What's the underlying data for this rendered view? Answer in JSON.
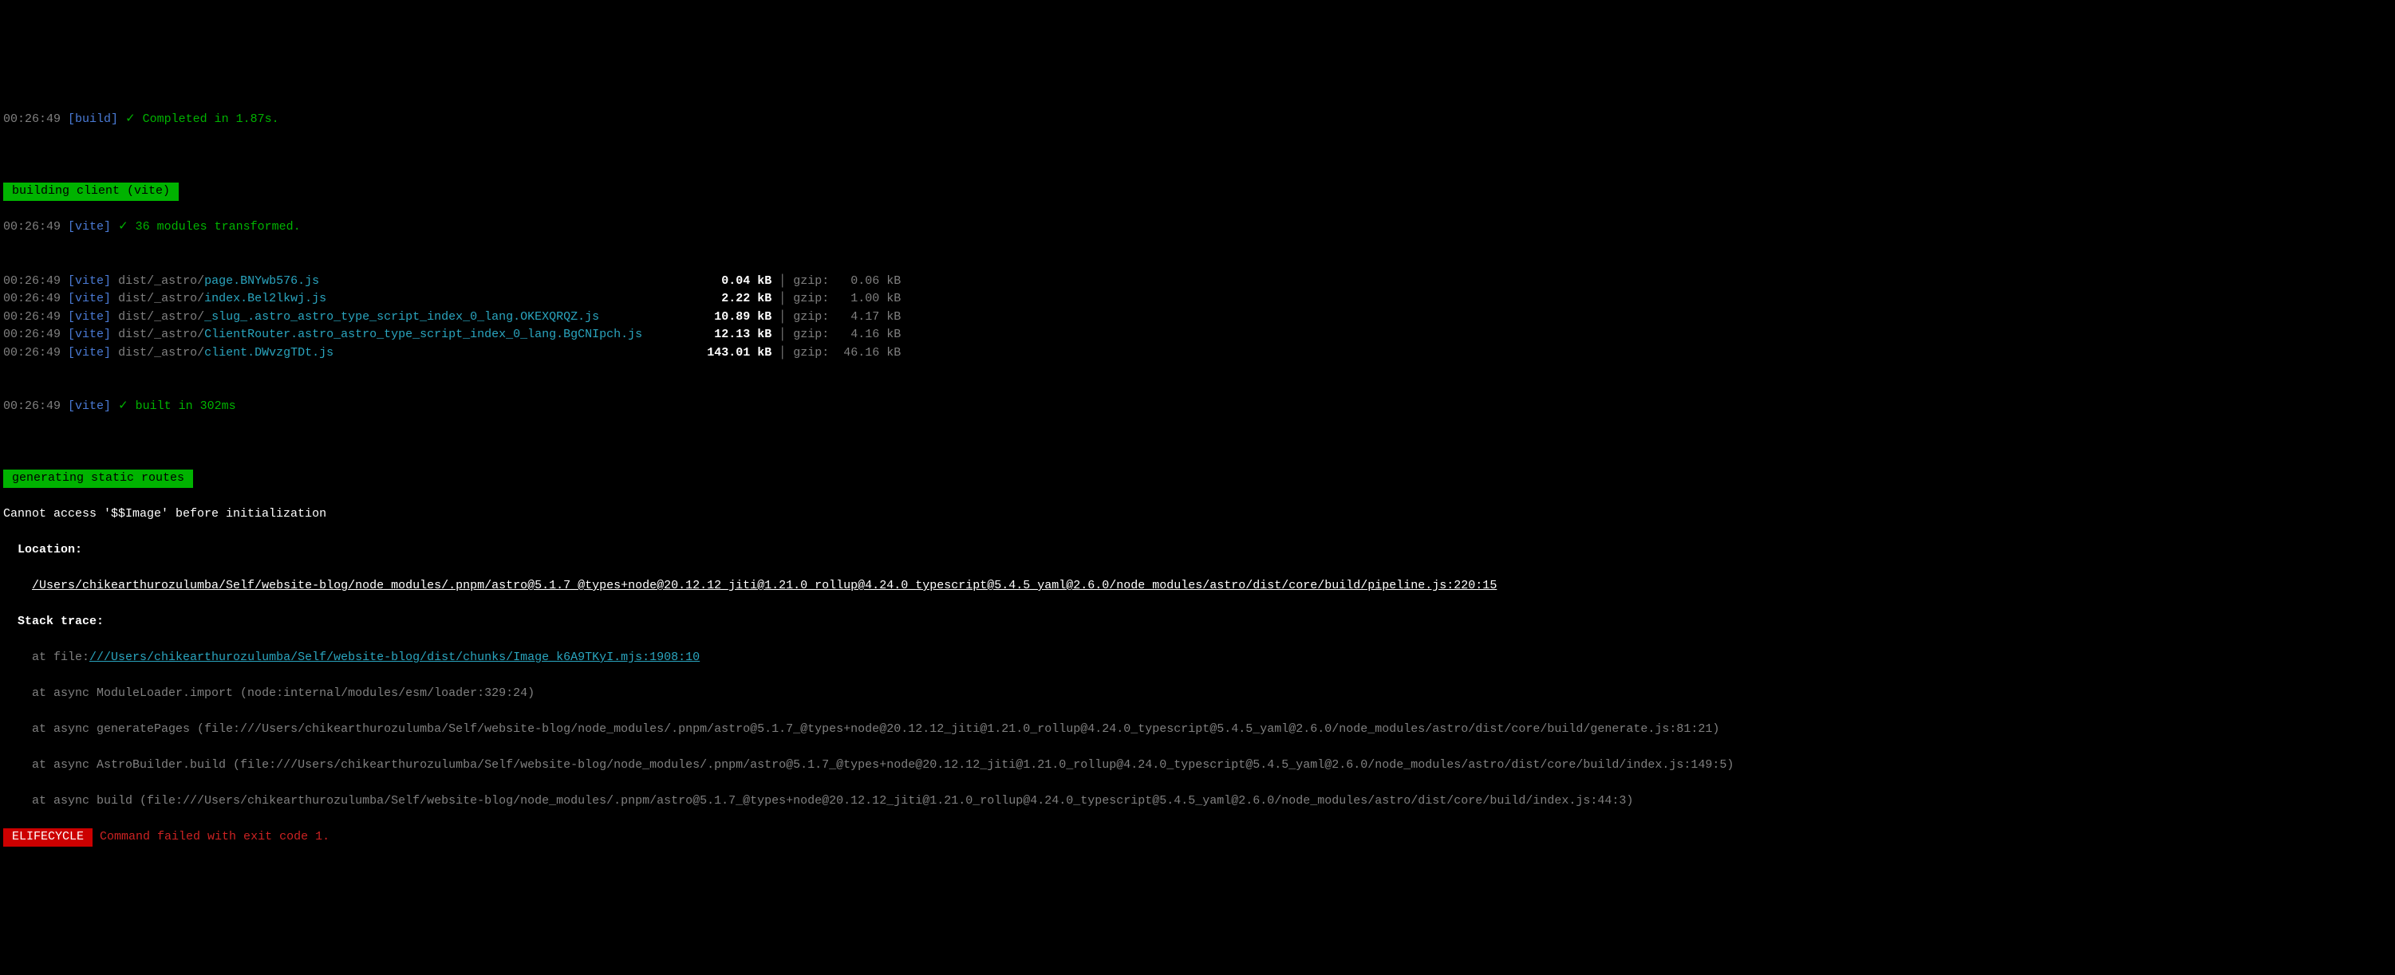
{
  "lines": {
    "l0": {
      "ts": "00:26:49",
      "tag": "[build]",
      "check": "✓",
      "msg": "Completed in 1.87s."
    },
    "banner1": " building client (vite) ",
    "l1": {
      "ts": "00:26:49",
      "tag": "[vite]",
      "check": "✓",
      "msg": "36 modules transformed."
    },
    "assets": [
      {
        "ts": "00:26:49",
        "tag": "[vite]",
        "prefix": "dist/_astro/",
        "file": "page.BNYwb576.js",
        "pad": "                                                      ",
        "size": "  0.04 kB",
        "gzip": "gzip:   0.06 kB"
      },
      {
        "ts": "00:26:49",
        "tag": "[vite]",
        "prefix": "dist/_astro/",
        "file": "index.Bel2lkwj.js",
        "pad": "                                                     ",
        "size": "  2.22 kB",
        "gzip": "gzip:   1.00 kB"
      },
      {
        "ts": "00:26:49",
        "tag": "[vite]",
        "prefix": "dist/_astro/",
        "file": "_slug_.astro_astro_type_script_index_0_lang.OKEXQRQZ.js",
        "pad": "               ",
        "size": " 10.89 kB",
        "gzip": "gzip:   4.17 kB"
      },
      {
        "ts": "00:26:49",
        "tag": "[vite]",
        "prefix": "dist/_astro/",
        "file": "ClientRouter.astro_astro_type_script_index_0_lang.BgCNIpch.js",
        "pad": "         ",
        "size": " 12.13 kB",
        "gzip": "gzip:   4.16 kB"
      },
      {
        "ts": "00:26:49",
        "tag": "[vite]",
        "prefix": "dist/_astro/",
        "file": "client.DWvzgTDt.js",
        "pad": "                                                    ",
        "size": "143.01 kB",
        "gzip": "gzip:  46.16 kB"
      }
    ],
    "l2": {
      "ts": "00:26:49",
      "tag": "[vite]",
      "check": "✓",
      "msg": "built in 302ms"
    },
    "banner2": " generating static routes ",
    "err": "Cannot access '$$Image' before initialization",
    "loc_label": "  Location:",
    "loc_path_pre": "    ",
    "loc_path": "/Users/chikearthurozulumba/Self/website-blog/node_modules/.pnpm/astro@5.1.7_@types+node@20.12.12_jiti@1.21.0_rollup@4.24.0_typescript@5.4.5_yaml@2.6.0/node_modules/astro/dist/core/build/pipeline.js:220:15",
    "stack_label": "  Stack trace:",
    "st0_pre": "    at file:",
    "st0_link": "///Users/chikearthurozulumba/Self/website-blog/dist/chunks/Image_k6A9TKyI.mjs:1908:10",
    "st1": "    at async ModuleLoader.import (node:internal/modules/esm/loader:329:24)",
    "st2": "    at async generatePages (file:///Users/chikearthurozulumba/Self/website-blog/node_modules/.pnpm/astro@5.1.7_@types+node@20.12.12_jiti@1.21.0_rollup@4.24.0_typescript@5.4.5_yaml@2.6.0/node_modules/astro/dist/core/build/generate.js:81:21)",
    "st3": "    at async AstroBuilder.build (file:///Users/chikearthurozulumba/Self/website-blog/node_modules/.pnpm/astro@5.1.7_@types+node@20.12.12_jiti@1.21.0_rollup@4.24.0_typescript@5.4.5_yaml@2.6.0/node_modules/astro/dist/core/build/index.js:149:5)",
    "st4": "    at async build (file:///Users/chikearthurozulumba/Self/website-blog/node_modules/.pnpm/astro@5.1.7_@types+node@20.12.12_jiti@1.21.0_rollup@4.24.0_typescript@5.4.5_yaml@2.6.0/node_modules/astro/dist/core/build/index.js:44:3)",
    "lifecycle_tag": " ELIFECYCLE ",
    "lifecycle_msg": " Command failed with exit code 1."
  }
}
